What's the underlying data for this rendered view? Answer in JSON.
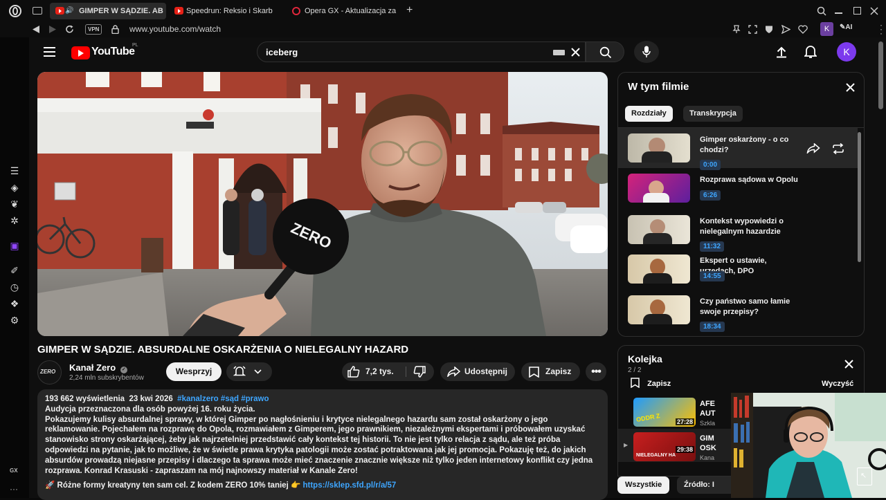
{
  "browser": {
    "tabs": [
      {
        "label": "GIMPER W SĄDZIE. AB",
        "active": true
      },
      {
        "label": "Speedrun: Reksio i Skarb",
        "active": false
      },
      {
        "label": "Opera GX - Aktualizacja za",
        "active": false
      }
    ],
    "new_tab_label": "+",
    "url": "www.youtube.com/watch",
    "vpn_label": "VPN",
    "ai_label": "AI",
    "profile_initial": "K"
  },
  "youtube": {
    "logo_text": "YouTube",
    "region": "PL",
    "search_value": "iceberg",
    "avatar_initial": "K"
  },
  "video": {
    "title": "GIMPER W SĄDZIE. ABSURDALNE OSKARŻENIA O NIELEGALNY HAZARD",
    "mic_text": "ZERO"
  },
  "channel": {
    "name": "Kanał Zero",
    "subscribers": "2,24 mln subskrybentów",
    "logo_text": "ZERO",
    "support_label": "Wesprzyj"
  },
  "actions": {
    "likes": "7,2 tys.",
    "share_label": "Udostępnij",
    "save_label": "Zapisz"
  },
  "description": {
    "views": "193 662 wyświetlenia",
    "date": "23 kwi 2026",
    "hashtags": "#kanalzero #sąd #prawo",
    "line1": "Audycja przeznaczona dla osób powyżej 16. roku życia.",
    "body": "Pokazujemy kulisy absurdalnej sprawy, w której Gimper po nagłośnieniu i krytyce nielegalnego hazardu sam został oskarżony o jego reklamowanie. Pojechałem na rozprawę do Opola, rozmawiałem z Gimperem, jego prawnikiem, niezależnymi ekspertami i próbowałem uzyskać stanowisko strony oskarżającej, żeby jak najrzetelniej przedstawić cały kontekst tej historii. To nie jest tylko relacja z sądu, ale też próba odpowiedzi na pytanie, jak to możliwe, że w świetle prawa krytyka patologii może zostać potraktowana jak jej promocja. Pokazuję też, do jakich absurdów prowadzą niejasne przepisy i dlaczego ta sprawa może mieć znaczenie znacznie większe niż tylko jeden internetowy konflikt czy jedna rozprawa. Konrad Krasuski - zapraszam na mój najnowszy materiał w Kanale Zero!",
    "promo_text": "🚀 Różne formy kreatyny ten sam cel. Z kodem ZERO 10% taniej 👉",
    "promo_link": "https://sklep.sfd.pl/r/a/57"
  },
  "chapters_panel": {
    "title": "W tym filmie",
    "tab_chapters": "Rozdziały",
    "tab_transcript": "Transkrypcja",
    "items": [
      {
        "title": "Gimper oskarżony - o co chodzi?",
        "time": "0:00"
      },
      {
        "title": "Rozprawa sądowa w Opolu",
        "time": "6:26"
      },
      {
        "title": "Kontekst wypowiedzi o nielegalnym hazardzie",
        "time": "11:32"
      },
      {
        "title": "Ekspert o ustawie, urzędach, DPO",
        "time": "14:55"
      },
      {
        "title": "Czy państwo samo łamie swoje przepisy?",
        "time": "18:34"
      }
    ]
  },
  "queue_panel": {
    "title": "Kolejka",
    "count": "2 / 2",
    "save_label": "Zapisz",
    "clear_label": "Wyczyść",
    "items": [
      {
        "title": "AFE AUT",
        "channel": "Szkla",
        "duration": "27:28",
        "thumb_text": "ODDR Z"
      },
      {
        "title": "GIM OSK",
        "channel": "Kana",
        "duration": "29:38",
        "thumb_text": "NIELEGALNY HA"
      }
    ]
  },
  "chips": {
    "all": "Wszystkie",
    "source": "Źródło: I"
  },
  "gx_label": "GX",
  "colors": {
    "yt_red": "#ff0000",
    "link_blue": "#3ea6ff",
    "avatar_purple": "#7c3aed",
    "panel_bg": "#0f0f0f"
  }
}
